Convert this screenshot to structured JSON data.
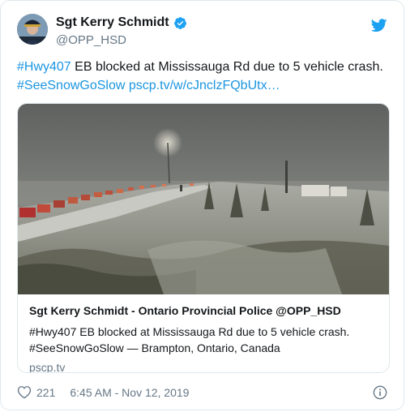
{
  "author": {
    "name": "Sgt Kerry Schmidt",
    "handle": "@OPP_HSD"
  },
  "tweet": {
    "hashtag1": "#Hwy407",
    "text1": " EB blocked at Mississauga Rd due to 5 vehicle crash.",
    "hashtag2": "#SeeSnowGoSlow",
    "link": "pscp.tv/w/cJnclzFQbUtx…"
  },
  "card": {
    "title": "Sgt Kerry Schmidt - Ontario Provincial Police @OPP_HSD",
    "desc_line1": "#Hwy407 EB blocked at Mississauga Rd due to 5 vehicle crash.",
    "desc_line2": "#SeeSnowGoSlow — Brampton, Ontario, Canada",
    "domain": "pscp.tv"
  },
  "footer": {
    "likes": "221",
    "timestamp": "6:45 AM - Nov 12, 2019"
  },
  "icons": {
    "verified": "verified-badge-icon",
    "bird": "twitter-bird-icon",
    "heart": "heart-icon",
    "info": "info-icon"
  },
  "colors": {
    "link": "#1b95e0",
    "secondary": "#657786",
    "border": "#e1e8ed"
  }
}
